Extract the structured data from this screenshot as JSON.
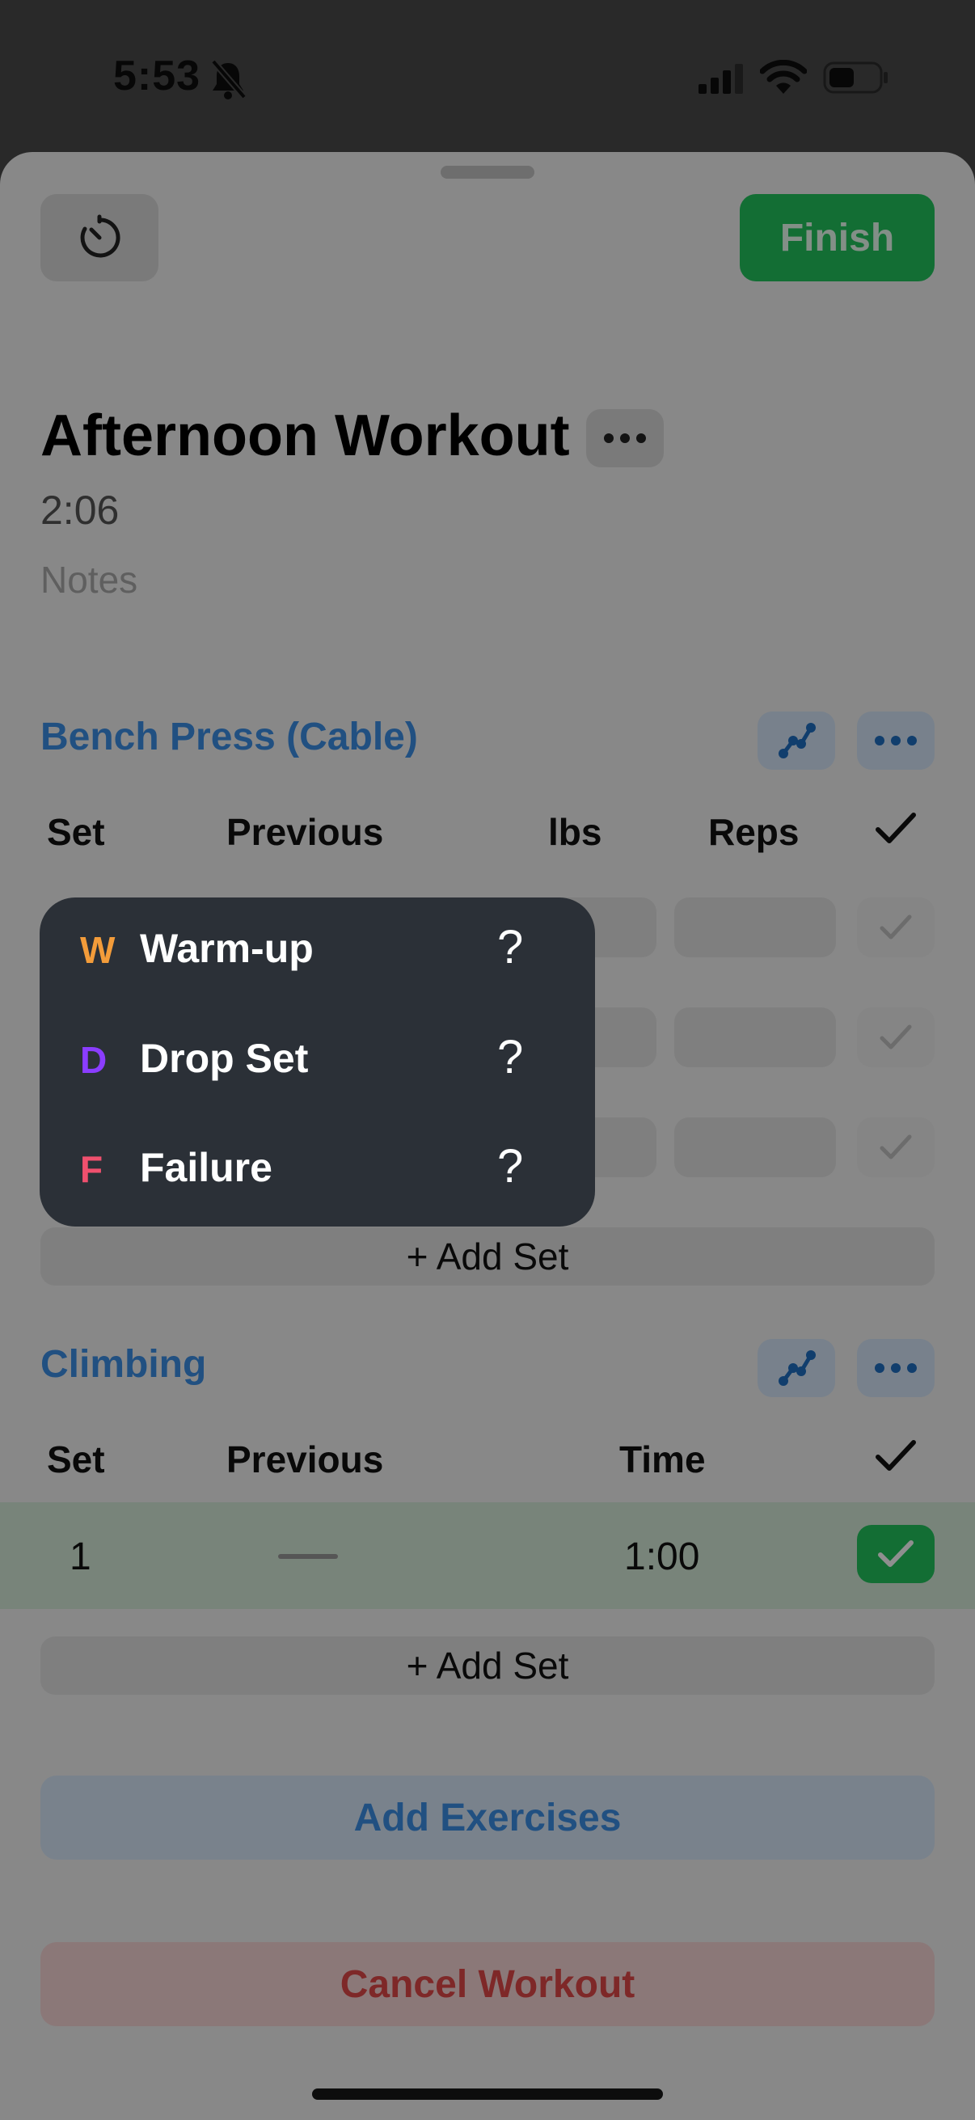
{
  "status_bar": {
    "time": "5:53"
  },
  "header": {
    "finish_label": "Finish"
  },
  "workout": {
    "title": "Afternoon Workout",
    "elapsed": "2:06",
    "notes_placeholder": "Notes"
  },
  "exercises": [
    {
      "name": "Bench Press (Cable)",
      "columns": {
        "set": "Set",
        "previous": "Previous",
        "weight": "lbs",
        "reps": "Reps"
      },
      "add_set_label": "+ Add Set"
    },
    {
      "name": "Climbing",
      "columns": {
        "set": "Set",
        "previous": "Previous",
        "time": "Time"
      },
      "rows": [
        {
          "set": "1",
          "previous": "—",
          "time": "1:00",
          "completed": true
        }
      ],
      "add_set_label": "+ Add Set"
    }
  ],
  "actions": {
    "add_exercises": "Add Exercises",
    "cancel_workout": "Cancel Workout"
  },
  "set_type_menu": {
    "items": [
      {
        "letter": "W",
        "label": "Warm-up",
        "letter_color": "#f39c3a",
        "help": "?"
      },
      {
        "letter": "D",
        "label": "Drop Set",
        "letter_color": "#8b3dff",
        "help": "?"
      },
      {
        "letter": "F",
        "label": "Failure",
        "letter_color": "#f0506e",
        "help": "?"
      }
    ]
  },
  "colors": {
    "accent": "#3b8fe6",
    "success": "#22c55e",
    "danger": "#e04848"
  }
}
